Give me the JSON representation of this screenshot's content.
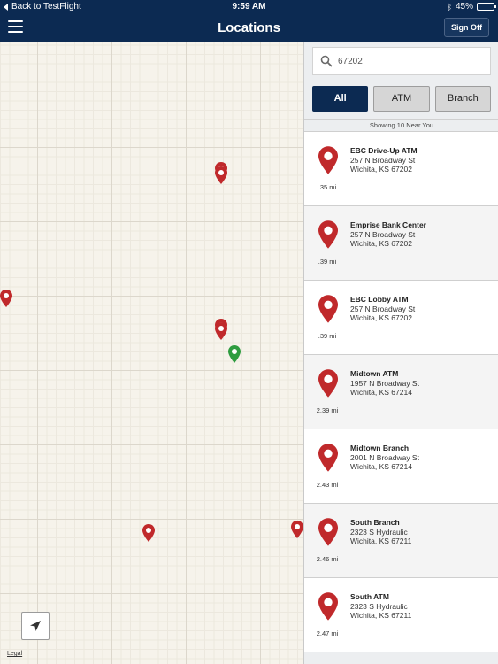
{
  "status_bar": {
    "back_label": "Back to TestFlight",
    "time": "9:59 AM",
    "battery": "45%",
    "battery_level": 0.45
  },
  "nav": {
    "title": "Locations",
    "sign_off": "Sign Off"
  },
  "search": {
    "value": "67202"
  },
  "filters": [
    "All",
    "ATM",
    "Branch"
  ],
  "selected_filter": "All",
  "showing_text": "Showing 10 Near You",
  "locations": [
    {
      "name": "EBC Drive-Up ATM",
      "address": "257 N Broadway St",
      "city": "Wichita, KS 67202",
      "distance": ".35 mi"
    },
    {
      "name": "Emprise Bank Center",
      "address": "257 N Broadway St",
      "city": "Wichita, KS 67202",
      "distance": ".39 mi"
    },
    {
      "name": "EBC Lobby ATM",
      "address": "257 N Broadway St",
      "city": "Wichita, KS 67202",
      "distance": ".39 mi"
    },
    {
      "name": "Midtown ATM",
      "address": "1957 N Broadway St",
      "city": "Wichita, KS 67214",
      "distance": "2.39 mi"
    },
    {
      "name": "Midtown Branch",
      "address": "2001 N Broadway St",
      "city": "Wichita, KS 67214",
      "distance": "2.43 mi"
    },
    {
      "name": "South Branch",
      "address": "2323 S Hydraulic",
      "city": "Wichita, KS 67211",
      "distance": "2.46 mi"
    },
    {
      "name": "South ATM",
      "address": "2323 S Hydraulic",
      "city": "Wichita, KS 67211",
      "distance": "2.47 mi"
    }
  ],
  "map": {
    "legal_label": "Legal",
    "pin_colors": {
      "location": "#c0292b",
      "user": "#2e9c3f"
    }
  },
  "colors": {
    "brand_navy": "#0c2a52",
    "pin_red": "#c0292b"
  }
}
